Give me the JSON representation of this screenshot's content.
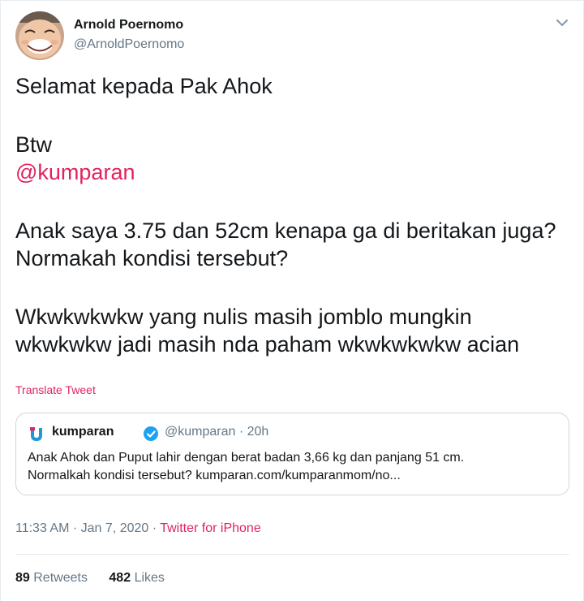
{
  "author": {
    "name": "Arnold Poernomo",
    "handle": "@ArnoldPoernomo"
  },
  "tweet": {
    "line1": "Selamat kepada Pak Ahok",
    "line2": "Btw",
    "mention": "@kumparan",
    "line3": "Anak saya 3.75 dan 52cm kenapa ga di beritakan juga?",
    "line4": "Normakah kondisi tersebut?",
    "line5": "Wkwkwkwkw yang nulis masih jomblo mungkin",
    "line6": "wkwkwkw jadi masih nda paham wkwkwkwkw acian",
    "translate_label": "Translate Tweet"
  },
  "quoted": {
    "name": "kumparan",
    "handle": "@kumparan",
    "separator": "·",
    "time": "20h",
    "text_line1": "Anak Ahok dan Puput lahir dengan berat badan 3,66 kg dan panjang 51 cm.",
    "text_line2": "Normalkah kondisi tersebut? kumparan.com/kumparanmom/no..."
  },
  "meta": {
    "time": "11:33 AM",
    "separator": "·",
    "date": "Jan 7, 2020",
    "source": "Twitter for iPhone"
  },
  "stats": {
    "retweets_count": "89",
    "retweets_label": "Retweets",
    "likes_count": "482",
    "likes_label": "Likes"
  },
  "colors": {
    "accent": "#e0245e",
    "secondary_text": "#657786",
    "border": "#e6ecf0",
    "verified": "#1da1f2",
    "kumparan_logo": "#1d9ad6"
  },
  "icons": {
    "caret": "chevron-down-icon",
    "verified": "verified-badge-icon",
    "logo": "kumparan-logo-icon"
  }
}
